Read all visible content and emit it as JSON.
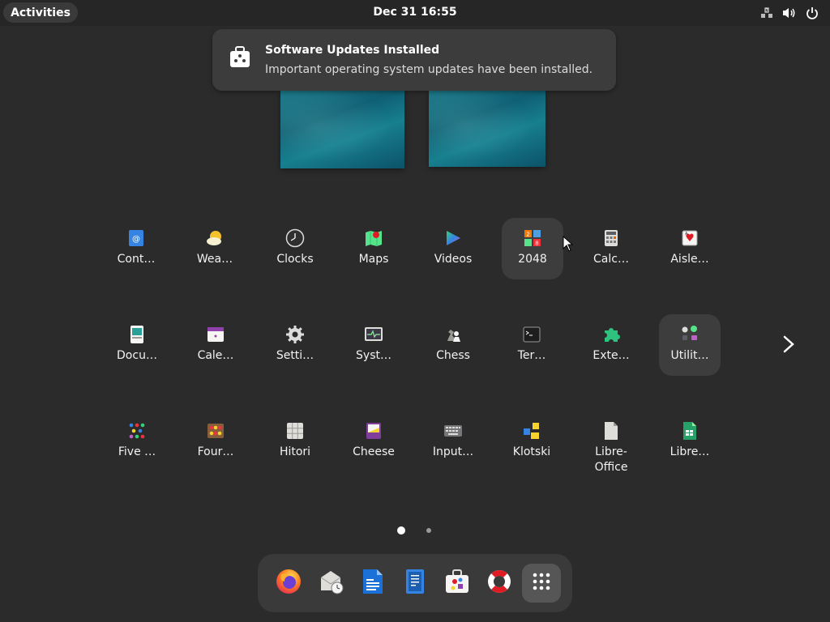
{
  "topbar": {
    "activities_label": "Activities",
    "clock": "Dec 31  16:55",
    "tray": [
      "network-question-icon",
      "volume-icon",
      "power-icon"
    ]
  },
  "notification": {
    "title": "Software Updates Installed",
    "body": "Important operating system updates have been installed.",
    "icon": "software-package-icon"
  },
  "app_grid": {
    "rows": [
      [
        {
          "label": "Cont…",
          "icon": "contacts-icon"
        },
        {
          "label": "Wea…",
          "icon": "weather-icon"
        },
        {
          "label": "Clocks",
          "icon": "clocks-icon"
        },
        {
          "label": "Maps",
          "icon": "maps-icon"
        },
        {
          "label": "Videos",
          "icon": "videos-icon"
        },
        {
          "label": "2048",
          "icon": "game-2048-icon",
          "highlighted": true
        },
        {
          "label": "Calc…",
          "icon": "calculator-icon"
        },
        {
          "label": "Aisle…",
          "icon": "aisleriot-icon"
        }
      ],
      [
        {
          "label": "Docu…",
          "icon": "document-viewer-icon"
        },
        {
          "label": "Cale…",
          "icon": "calendar-icon"
        },
        {
          "label": "Setti…",
          "icon": "settings-gear-icon"
        },
        {
          "label": "Syst…",
          "icon": "system-monitor-icon"
        },
        {
          "label": "Chess",
          "icon": "chess-icon"
        },
        {
          "label": "Ter…",
          "icon": "terminal-icon"
        },
        {
          "label": "Exte…",
          "icon": "extensions-icon"
        },
        {
          "label": "Utilit…",
          "icon": "utilities-folder-icon",
          "highlighted": true
        }
      ],
      [
        {
          "label": "Five …",
          "icon": "five-or-more-icon"
        },
        {
          "label": "Four…",
          "icon": "four-in-a-row-icon"
        },
        {
          "label": "Hitori",
          "icon": "hitori-icon"
        },
        {
          "label": "Cheese",
          "icon": "cheese-icon"
        },
        {
          "label": "Input…",
          "icon": "input-method-icon"
        },
        {
          "label": "Klotski",
          "icon": "klotski-icon"
        },
        {
          "label": "Libre-\nOffice",
          "icon": "libreoffice-icon"
        },
        {
          "label": "Libre…",
          "icon": "libreoffice-calc-icon"
        }
      ]
    ]
  },
  "pagination": {
    "pages": 2,
    "current": 1
  },
  "dock": {
    "items": [
      {
        "name": "firefox-icon"
      },
      {
        "name": "mail-clock-icon"
      },
      {
        "name": "writer-document-icon"
      },
      {
        "name": "text-editor-icon"
      },
      {
        "name": "software-store-icon"
      },
      {
        "name": "help-lifebuoy-icon"
      },
      {
        "name": "show-apps-grid-icon",
        "active": true
      }
    ]
  },
  "colors": {
    "background": "#2b2b2b",
    "topbar": "#262626",
    "panel": "#3c3c3c",
    "accent_blue": "#3584e4"
  }
}
